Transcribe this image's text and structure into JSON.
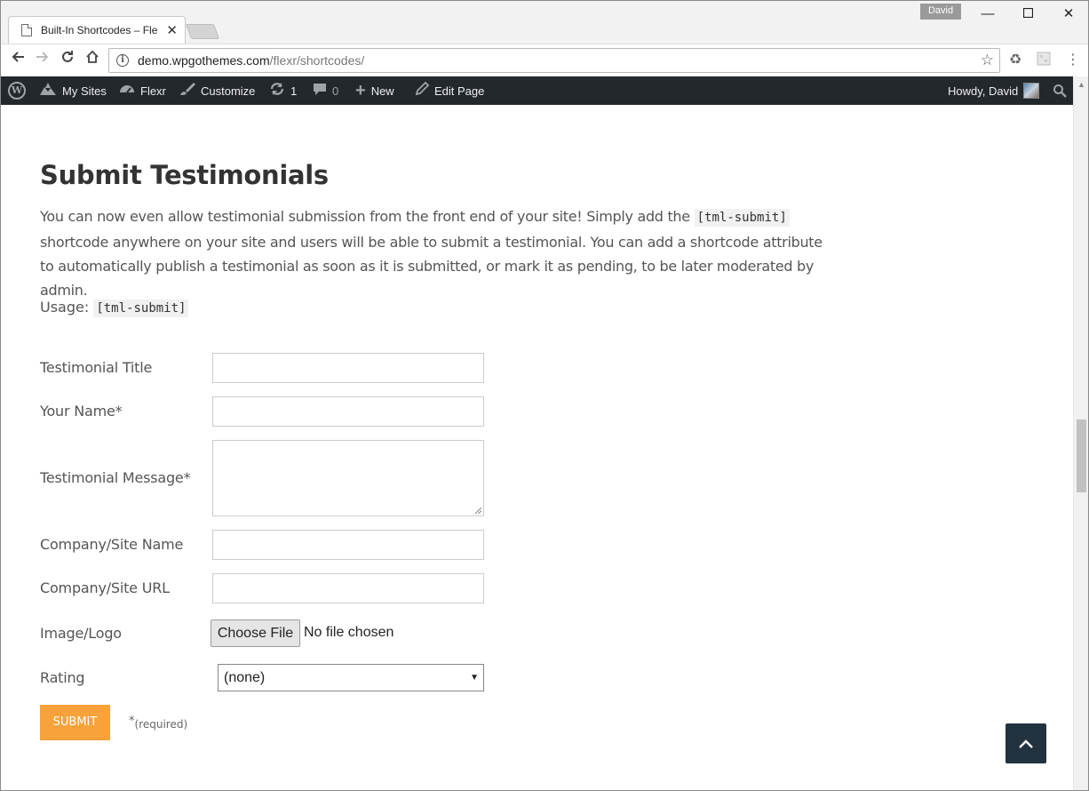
{
  "browser": {
    "tab_title": "Built-In Shortcodes – Fle",
    "profile_name": "David",
    "url_host": "demo.wpgothemes.com",
    "url_path": "/flexr/shortcodes/"
  },
  "adminbar": {
    "my_sites": "My Sites",
    "site": "Flexr",
    "customize": "Customize",
    "updates_count": "1",
    "comments_count": "0",
    "new": "New",
    "edit_page": "Edit Page",
    "howdy": "Howdy, David"
  },
  "content": {
    "heading": "Submit Testimonials",
    "intro_before": "You can now even allow testimonial submission from the front end of your site! Simply add the ",
    "intro_code": "[tml-submit]",
    "intro_after": " shortcode anywhere on your site and users will be able to submit a testimonial. You can add a shortcode attribute to automatically publish a testimonial as soon as it is submitted, or mark it as pending, to be later moderated by admin.",
    "usage_label": "Usage: ",
    "usage_code": "[tml-submit]"
  },
  "form": {
    "fields": [
      {
        "label": "Testimonial Title",
        "value": ""
      },
      {
        "label": "Your Name*",
        "value": ""
      },
      {
        "label": "Testimonial Message*",
        "value": ""
      },
      {
        "label": "Company/Site Name",
        "value": ""
      },
      {
        "label": "Company/Site URL",
        "value": ""
      }
    ],
    "image_label": "Image/Logo",
    "file_button": "Choose File",
    "file_status": "No file chosen",
    "rating_label": "Rating",
    "rating_selected": "(none)",
    "submit_label": "SUBMIT",
    "required_star": "*",
    "required_text": "(required)"
  },
  "colors": {
    "adminbar_bg": "#23282d",
    "submit_bg": "#f7a23a",
    "back_to_top_bg": "#23323f"
  }
}
